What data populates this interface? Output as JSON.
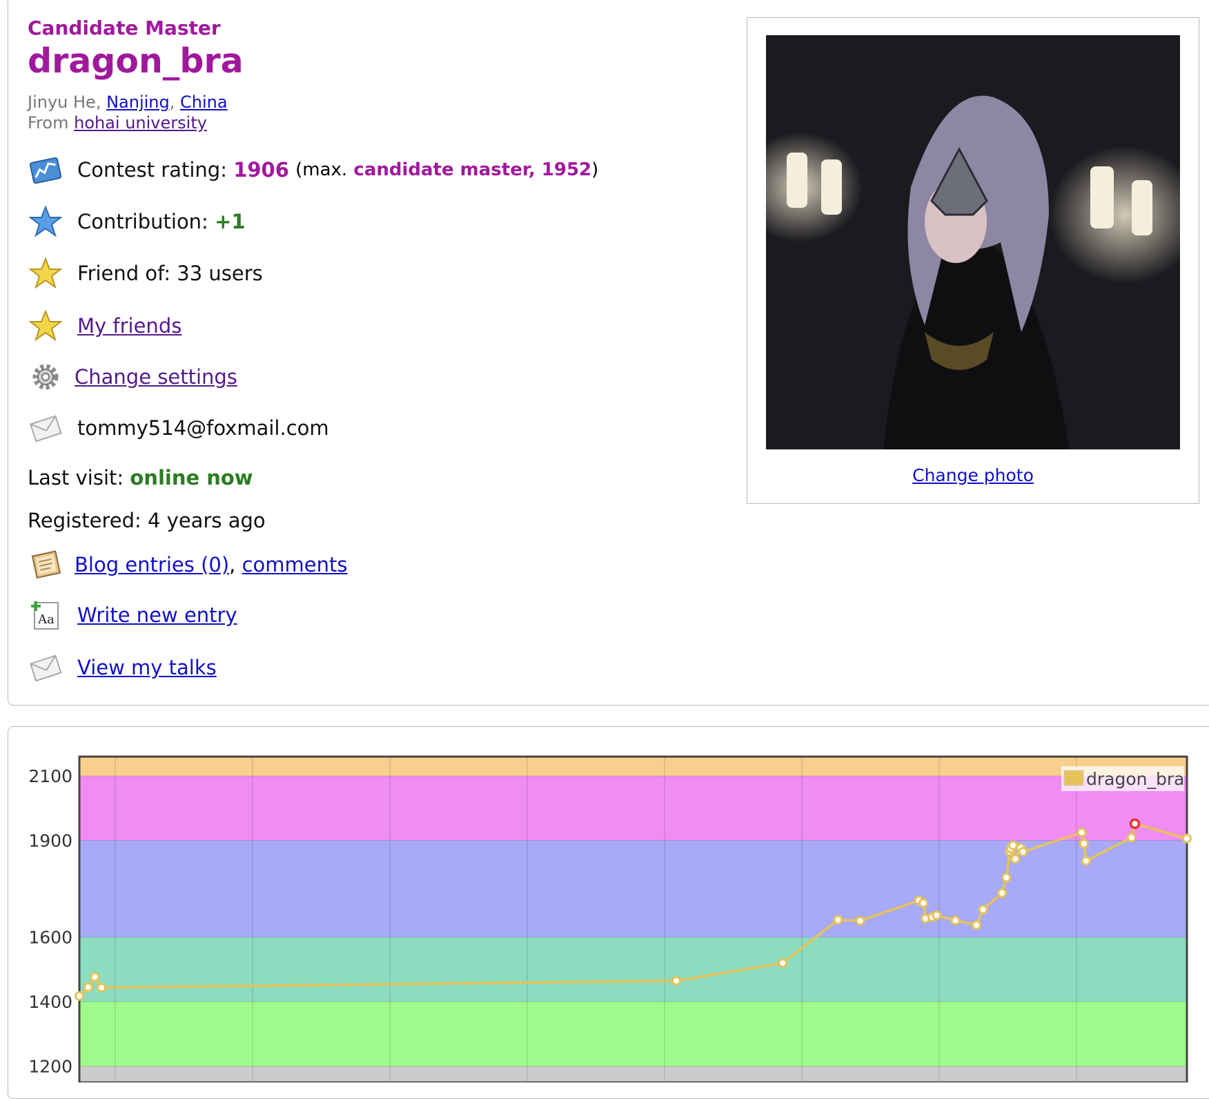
{
  "profile": {
    "rank": "Candidate Master",
    "handle": "dragon_bra",
    "name": "Jinyu He",
    "city": "Nanjing",
    "country": "China",
    "from_label": "From",
    "organization": "hohai university",
    "contest_rating_label": "Contest rating:",
    "contest_rating": "1906",
    "max_prefix": "(max.",
    "max_value": "candidate master, 1952",
    "max_suffix": ")",
    "contribution_label": "Contribution:",
    "contribution": "+1",
    "friend_of": "Friend of: 33 users",
    "my_friends": "My friends",
    "change_settings": "Change settings",
    "email": "tommy514@foxmail.com",
    "last_visit_label": "Last visit:",
    "last_visit": "online now",
    "registered": "Registered: 4 years ago",
    "blog_entries": "Blog entries (0)",
    "comments": "comments",
    "write_new_entry": "Write new entry",
    "view_talks": "View my talks",
    "change_photo": "Change photo"
  },
  "icons": [
    "rating-chart-icon",
    "contribution-star-icon",
    "friend-star-icon",
    "my-friends-star-icon",
    "settings-gear-icon",
    "email-envelope-icon",
    "blog-notebook-icon",
    "write-entry-icon",
    "talks-envelope-icon"
  ],
  "colors": {
    "rank_purple": "#a0199c",
    "online_green": "#2b7d21",
    "link_blue": "#1010c8",
    "band_master": "#f9cf8e",
    "band_candidate_master": "#f08df2",
    "band_expert": "#a8aaf7",
    "band_specialist": "#8cdcbf",
    "band_pupil": "#9ffa8b",
    "band_newbie": "#cccccc",
    "series_line": "#e6c35a",
    "max_point": "#e53030"
  },
  "chart_data": {
    "type": "line",
    "yticks": [
      1200,
      1400,
      1600,
      1900,
      2100
    ],
    "ylim": [
      1150,
      2160
    ],
    "x_range": [
      0,
      100
    ],
    "grid": true,
    "legend": "top-right",
    "series": [
      {
        "name": "dragon_bra",
        "x": [
          0,
          0.8,
          1.4,
          2.0,
          53.9,
          63.5,
          68.5,
          70.5,
          75.8,
          76.2,
          76.4,
          77.0,
          77.4,
          79.1,
          81.0,
          81.6,
          83.3,
          83.7,
          84.0,
          84.1,
          84.3,
          84.5,
          85.0,
          85.2,
          90.5,
          90.7,
          90.9,
          95.0,
          95.3,
          100
        ],
        "y": [
          1418,
          1445,
          1477,
          1444,
          1465,
          1520,
          1654,
          1651,
          1714,
          1706,
          1658,
          1662,
          1668,
          1652,
          1638,
          1686,
          1737,
          1785,
          1866,
          1875,
          1885,
          1843,
          1877,
          1865,
          1925,
          1890,
          1837,
          1909,
          1952,
          1906
        ],
        "max_index": 28
      }
    ],
    "bands": [
      {
        "from": 2100,
        "to": 2160,
        "color": "#f9cf8e"
      },
      {
        "from": 1900,
        "to": 2100,
        "color": "#f08df2"
      },
      {
        "from": 1600,
        "to": 1900,
        "color": "#a8aaf7"
      },
      {
        "from": 1400,
        "to": 1600,
        "color": "#8cdcbf"
      },
      {
        "from": 1200,
        "to": 1400,
        "color": "#9ffa8b"
      },
      {
        "from": 1150,
        "to": 1200,
        "color": "#cccccc"
      }
    ]
  }
}
